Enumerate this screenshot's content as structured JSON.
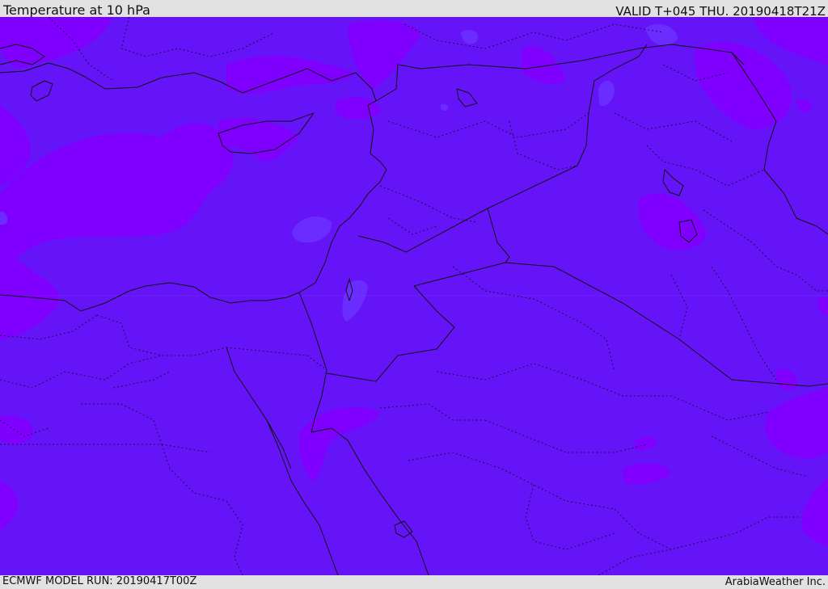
{
  "header": {
    "title": "Temperature at 10 hPa",
    "valid_time": "VALID T+045 THU. 20190418T21Z"
  },
  "footer": {
    "model_run": "ECMWF MODEL RUN: 20190417T00Z",
    "credit": "ArabiaWeather Inc."
  },
  "colors": {
    "field_base": "#6514f8",
    "field_warm": "#7f00ff",
    "field_cool": "#6b2dff",
    "border_solid": "#111111",
    "border_dotted": "#1a0b4a",
    "frame": "#e2e2e2"
  }
}
